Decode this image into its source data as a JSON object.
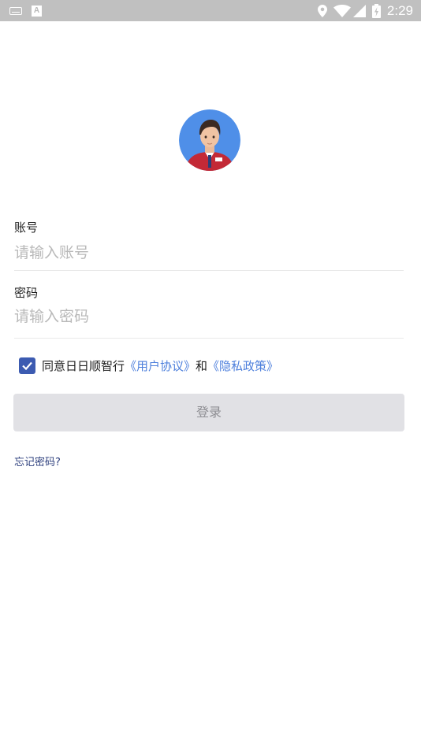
{
  "status_bar": {
    "time": "2:29",
    "icons": [
      "keyboard-icon",
      "a-icon",
      "location-icon",
      "wifi-icon",
      "signal-icon",
      "battery-icon"
    ],
    "a_glyph": "A"
  },
  "avatar": {
    "icon": "avatar-icon"
  },
  "account": {
    "label": "账号",
    "placeholder": "请输入账号",
    "value": ""
  },
  "password": {
    "label": "密码",
    "placeholder": "请输入密码",
    "value": ""
  },
  "agreement": {
    "checked": true,
    "prefix": "同意日日顺智行",
    "user_agreement": "《用户协议》",
    "conjunction": "和",
    "privacy_policy": "《隐私政策》"
  },
  "login_button": {
    "label": "登录"
  },
  "forgot_password": {
    "label": "忘记密码?"
  },
  "colors": {
    "status_bar_bg": "#c0c0c0",
    "checkbox": "#3c5bb1",
    "link": "#4d7fdc",
    "button_bg": "#e1e1e5",
    "button_text": "#8e8e93",
    "forgot_text": "#2d3f7d"
  }
}
